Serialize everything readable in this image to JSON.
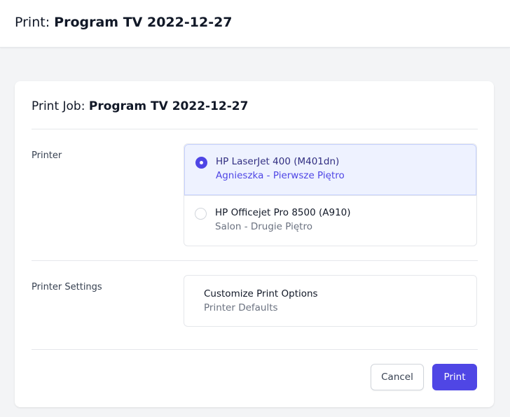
{
  "header": {
    "title_prefix": "Print:",
    "title_name": "Program TV 2022-12-27"
  },
  "card": {
    "title_prefix": "Print Job:",
    "title_name": "Program TV 2022-12-27"
  },
  "printer_section": {
    "label": "Printer",
    "options": [
      {
        "name": "HP LaserJet 400 (M401dn)",
        "location": "Agnieszka - Pierwsze Piętro",
        "selected": true
      },
      {
        "name": "HP Officejet Pro 8500 (A910)",
        "location": "Salon - Drugie Piętro",
        "selected": false
      }
    ]
  },
  "settings_section": {
    "label": "Printer Settings",
    "title": "Customize Print Options",
    "subtitle": "Printer Defaults"
  },
  "actions": {
    "cancel_label": "Cancel",
    "print_label": "Print"
  },
  "colors": {
    "accent": "#4f46e5",
    "selected_bg": "#eef2ff",
    "page_bg": "#f3f4f6"
  }
}
